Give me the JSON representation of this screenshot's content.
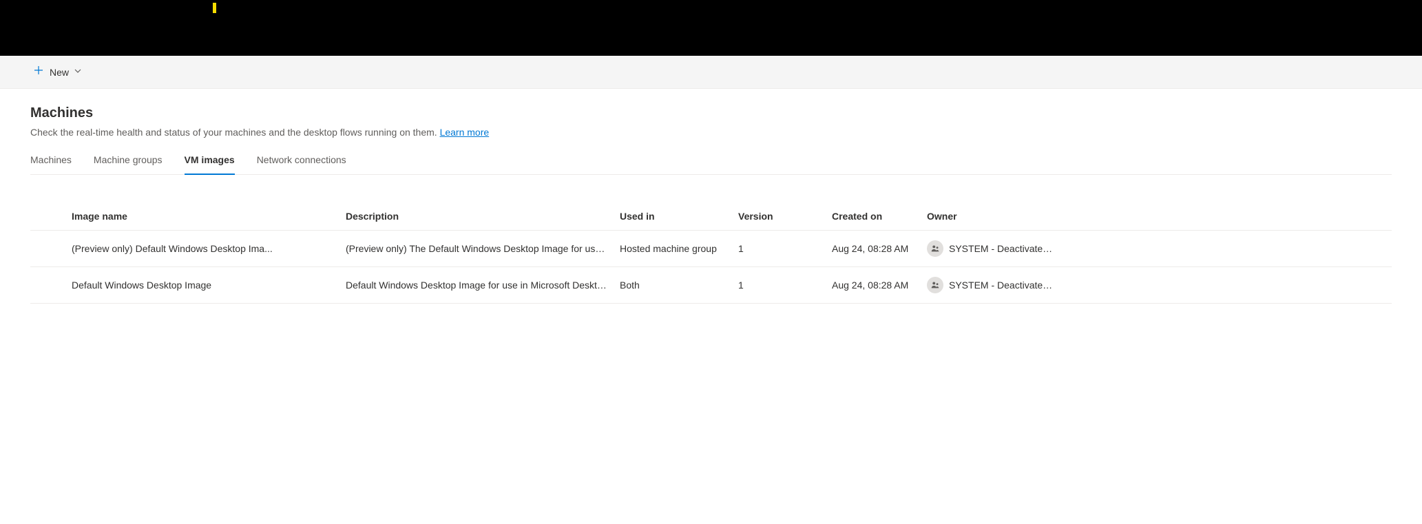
{
  "commandBar": {
    "newLabel": "New"
  },
  "page": {
    "title": "Machines",
    "subtitle": "Check the real-time health and status of your machines and the desktop flows running on them.",
    "learnMore": "Learn more"
  },
  "tabs": [
    {
      "label": "Machines",
      "active": false
    },
    {
      "label": "Machine groups",
      "active": false
    },
    {
      "label": "VM images",
      "active": true
    },
    {
      "label": "Network connections",
      "active": false
    }
  ],
  "table": {
    "headers": {
      "name": "Image name",
      "description": "Description",
      "usedIn": "Used in",
      "version": "Version",
      "createdOn": "Created on",
      "owner": "Owner"
    },
    "rows": [
      {
        "name": "(Preview only) Default Windows Desktop Ima...",
        "description": "(Preview only) The Default Windows Desktop Image for use i...",
        "usedIn": "Hosted machine group",
        "version": "1",
        "createdOn": "Aug 24, 08:28 AM",
        "owner": "SYSTEM - Deactivated..."
      },
      {
        "name": "Default Windows Desktop Image",
        "description": "Default Windows Desktop Image for use in Microsoft Deskto...",
        "usedIn": "Both",
        "version": "1",
        "createdOn": "Aug 24, 08:28 AM",
        "owner": "SYSTEM - Deactivated..."
      }
    ]
  }
}
